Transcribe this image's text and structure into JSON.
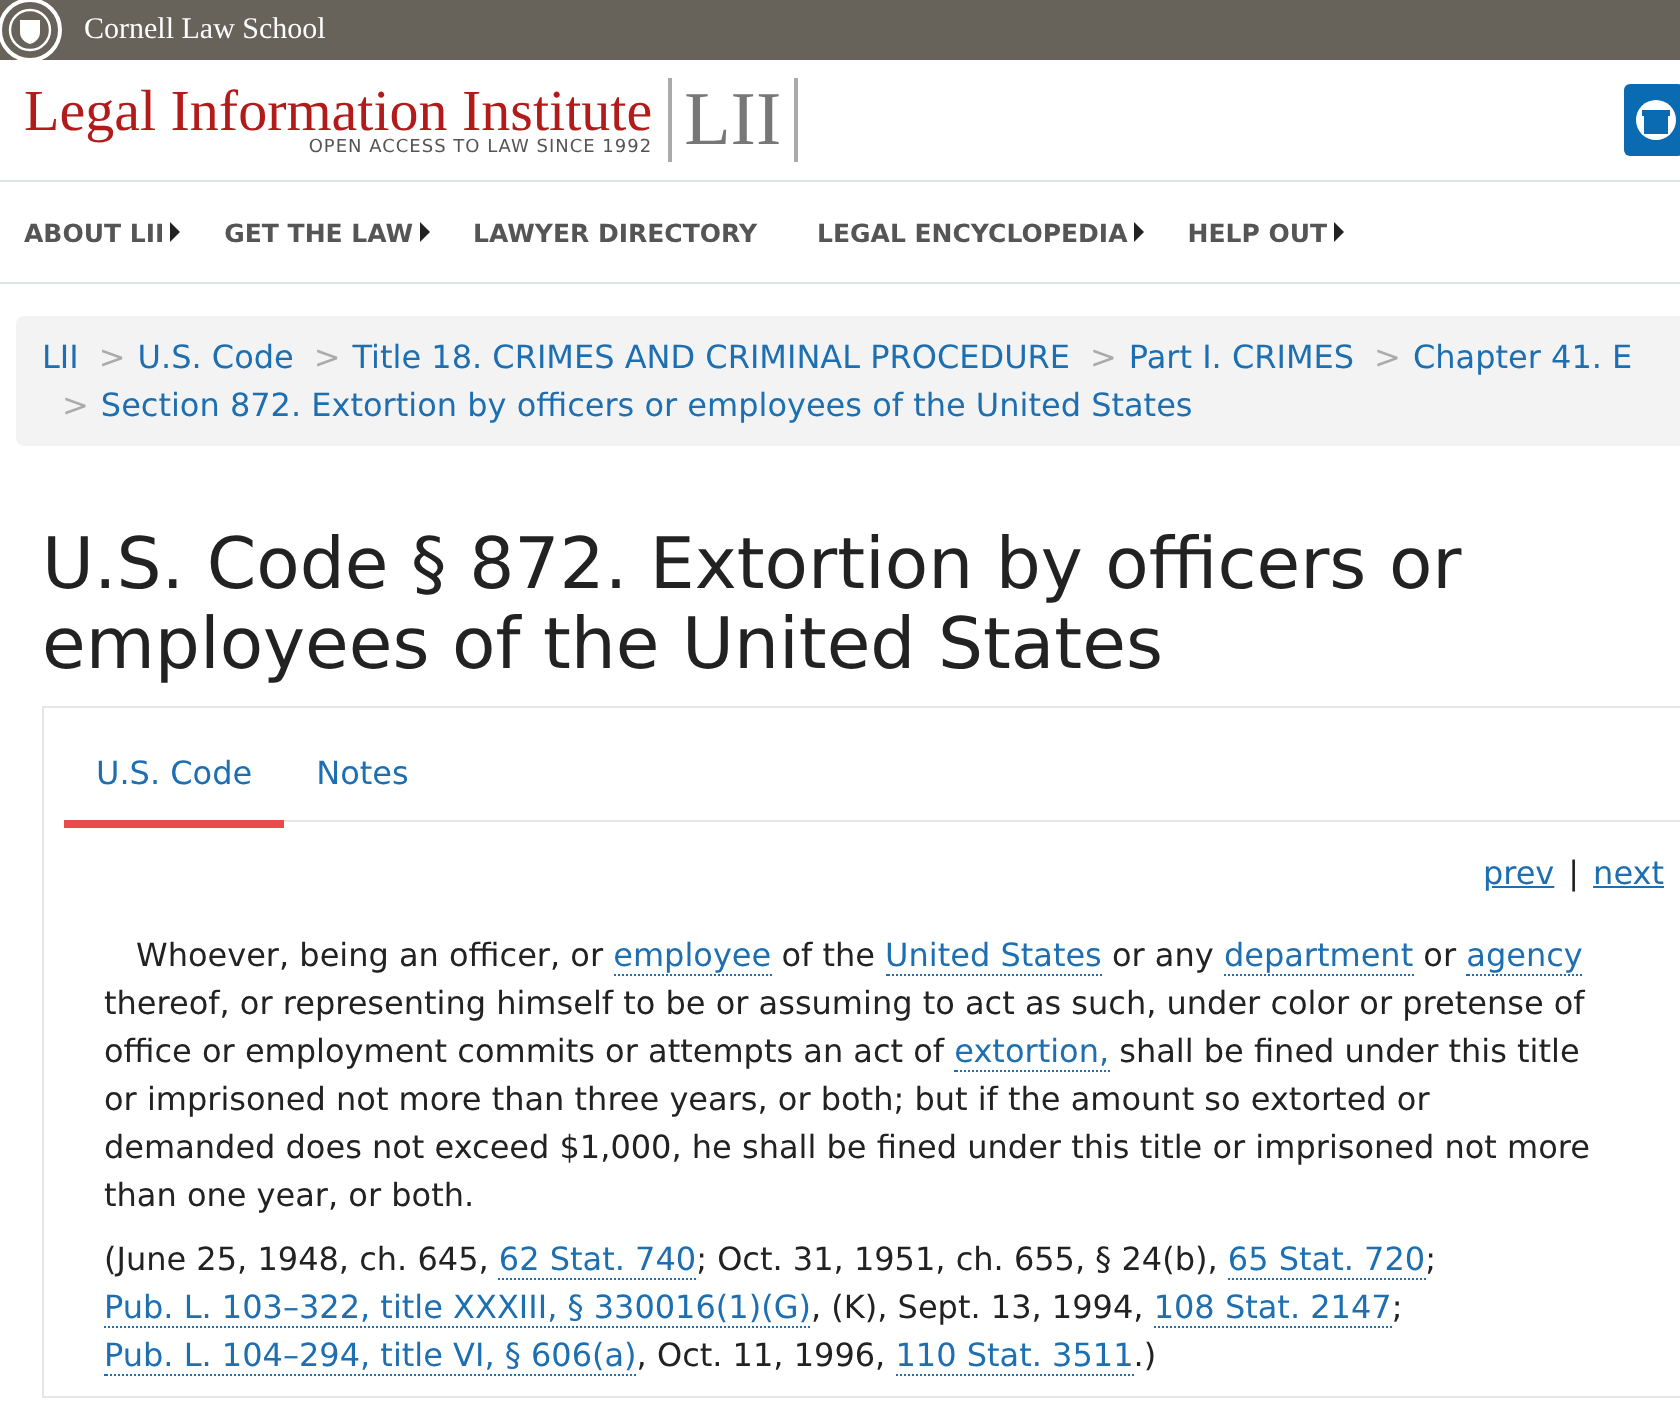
{
  "topbar": {
    "school": "Cornell Law School"
  },
  "header": {
    "title": "Legal Information Institute",
    "tagline": "OPEN ACCESS TO LAW SINCE 1992",
    "logo": "LII"
  },
  "nav": [
    {
      "label": "ABOUT LII",
      "has_menu": true
    },
    {
      "label": "GET THE LAW",
      "has_menu": true
    },
    {
      "label": "LAWYER DIRECTORY",
      "has_menu": false
    },
    {
      "label": "LEGAL ENCYCLOPEDIA",
      "has_menu": true
    },
    {
      "label": "HELP OUT",
      "has_menu": true
    }
  ],
  "breadcrumb": [
    {
      "label": "LII"
    },
    {
      "separator": ">",
      "label": "U.S. Code"
    },
    {
      "separator": ">",
      "label": "Title 18. CRIMES AND CRIMINAL PROCEDURE"
    },
    {
      "separator": ">",
      "label": "Part I. CRIMES"
    },
    {
      "separator": ">",
      "label": "Chapter 41. E"
    },
    {
      "separator": ">",
      "label": "Section 872. Extortion by officers or employees of the United States"
    }
  ],
  "page_title": "U.S. Code § 872. Extortion by officers or employees of the United States",
  "tabs": [
    {
      "label": "U.S. Code",
      "selected": true
    },
    {
      "label": "Notes",
      "selected": false
    }
  ],
  "pager": {
    "prev": "prev",
    "separator": "|",
    "next": "next"
  },
  "paragraphs": [
    {
      "kind": "body",
      "segments": [
        {
          "text": "Whoever, being an officer, or "
        },
        {
          "text": "employee",
          "link": true
        },
        {
          "text": " of the "
        },
        {
          "text": "United States",
          "link": true
        },
        {
          "text": " or any "
        },
        {
          "text": "department",
          "link": true
        },
        {
          "text": " or "
        },
        {
          "text": "agency",
          "link": true
        },
        {
          "text": " thereof, or representing himself to be or assuming to act as such, under color or pretense of office or employment commits or attempts an act of "
        },
        {
          "text": "extortion,",
          "link": true
        },
        {
          "text": " shall be fined under this title or imprisoned not more than three years, or both; but if the amount so extorted or demanded does not exceed $1,000, he shall be fined under this title or imprisoned not more than one year, or both."
        }
      ]
    },
    {
      "kind": "source",
      "segments": [
        {
          "text": "(June 25, 1948, ch. 645, "
        },
        {
          "text": "62 Stat. 740",
          "link": true
        },
        {
          "text": "; Oct. 31, 1951, ch. 655, § 24(b), "
        },
        {
          "text": "65 Stat. 720",
          "link": true
        },
        {
          "text": "; "
        },
        {
          "text": "Pub. L. 103–322, title XXXIII, § 330016(1)(G)",
          "link": true
        },
        {
          "text": ", (K), Sept. 13, 1994, "
        },
        {
          "text": "108 Stat. 2147",
          "link": true
        },
        {
          "text": "; "
        },
        {
          "text": "Pub. L. 104–294, title VI, § 606(a)",
          "link": true
        },
        {
          "text": ", Oct. 11, 1996, "
        },
        {
          "text": "110 Stat. 3511",
          "link": true
        },
        {
          "text": ".)"
        }
      ]
    }
  ]
}
